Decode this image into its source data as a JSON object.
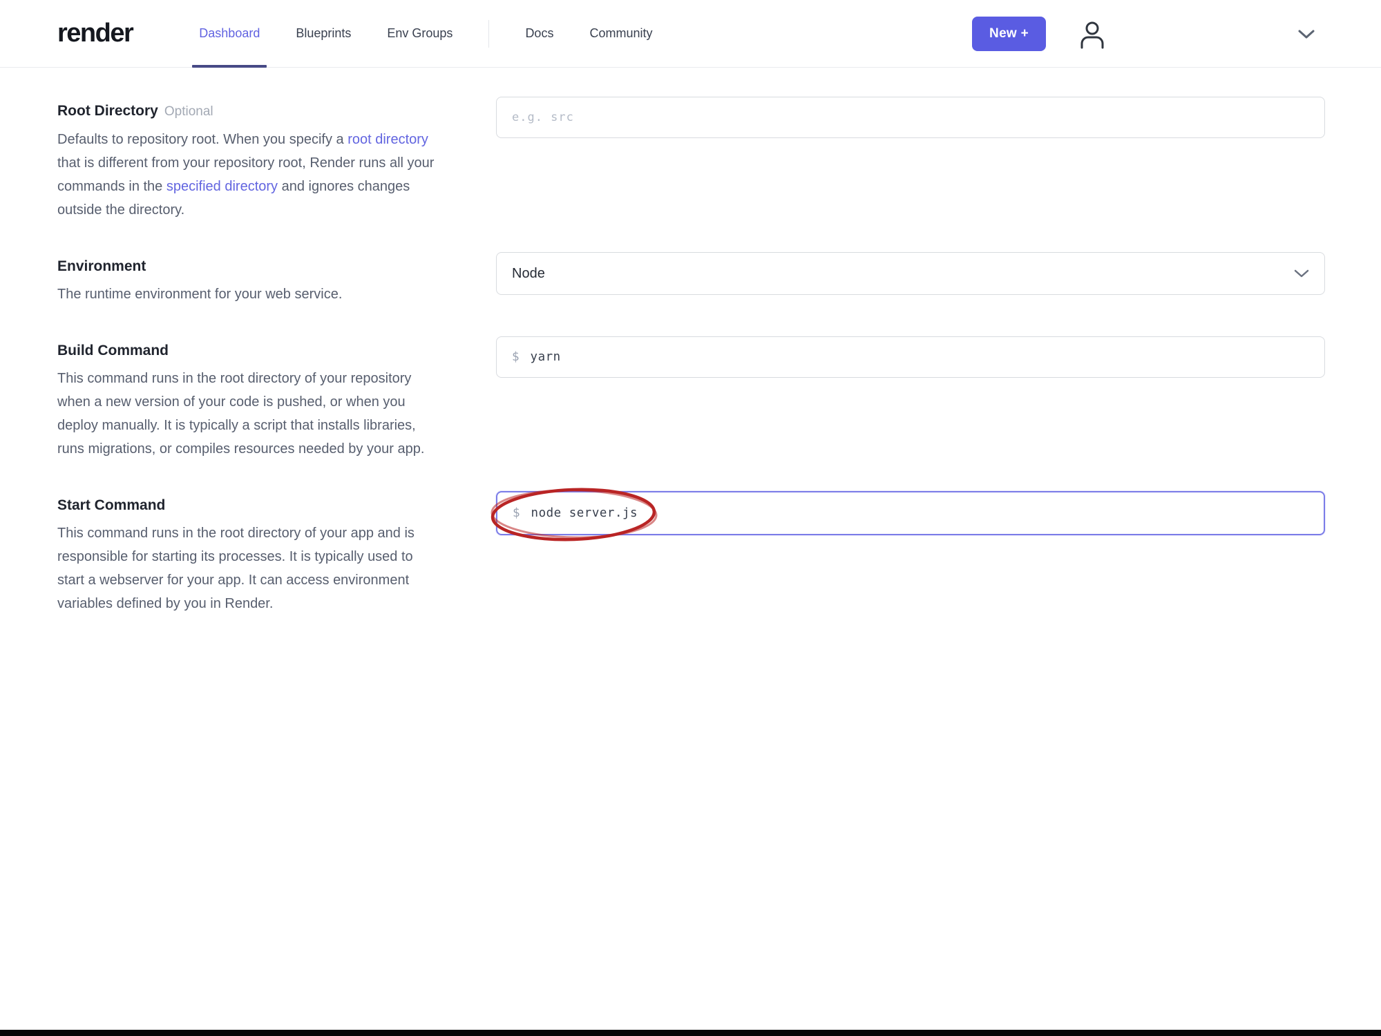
{
  "header": {
    "logo_text": "render",
    "nav": [
      {
        "label": "Dashboard",
        "active": true
      },
      {
        "label": "Blueprints",
        "active": false
      },
      {
        "label": "Env Groups",
        "active": false
      },
      {
        "label": "Docs",
        "active": false
      },
      {
        "label": "Community",
        "active": false
      }
    ],
    "new_button_label": "New +"
  },
  "form": {
    "sections": [
      {
        "label": "Root Directory",
        "badge": "Optional",
        "desc": {
          "p1": "Defaults to repository root. When you specify a ",
          "link1": "root directory",
          "p2": " that is different from your repository root, Render runs all your commands in the ",
          "link2": "specified directory",
          "p3": " and ignores changes outside the directory."
        },
        "field": {
          "type": "text",
          "placeholder": "e.g. src",
          "value": ""
        }
      },
      {
        "label": "Environment",
        "desc": "The runtime environment for your web service.",
        "field": {
          "type": "select",
          "value": "Node"
        }
      },
      {
        "label": "Build Command",
        "desc": "This command runs in the root directory of your repository when a new version of your code is pushed, or when you deploy manually. It is typically a script that installs libraries, runs migrations, or compiles resources needed by your app.",
        "field": {
          "type": "command",
          "prompt": "$",
          "value": "yarn"
        }
      },
      {
        "label": "Start Command",
        "desc": "This command runs in the root directory of your app and is responsible for starting its processes. It is typically used to start a webserver for your app. It can access environment variables defined by you in Render.",
        "field": {
          "type": "command",
          "prompt": "$",
          "value": "node server.js",
          "focused": true,
          "annotation": "red-ellipse"
        }
      }
    ]
  },
  "colors": {
    "accent": "#5a5ce2",
    "link": "#6265e0",
    "active_tab": "#6163e1",
    "active_underline": "#474a86",
    "focus_border": "#7b7ce8",
    "annotation_red": "#b92525"
  }
}
